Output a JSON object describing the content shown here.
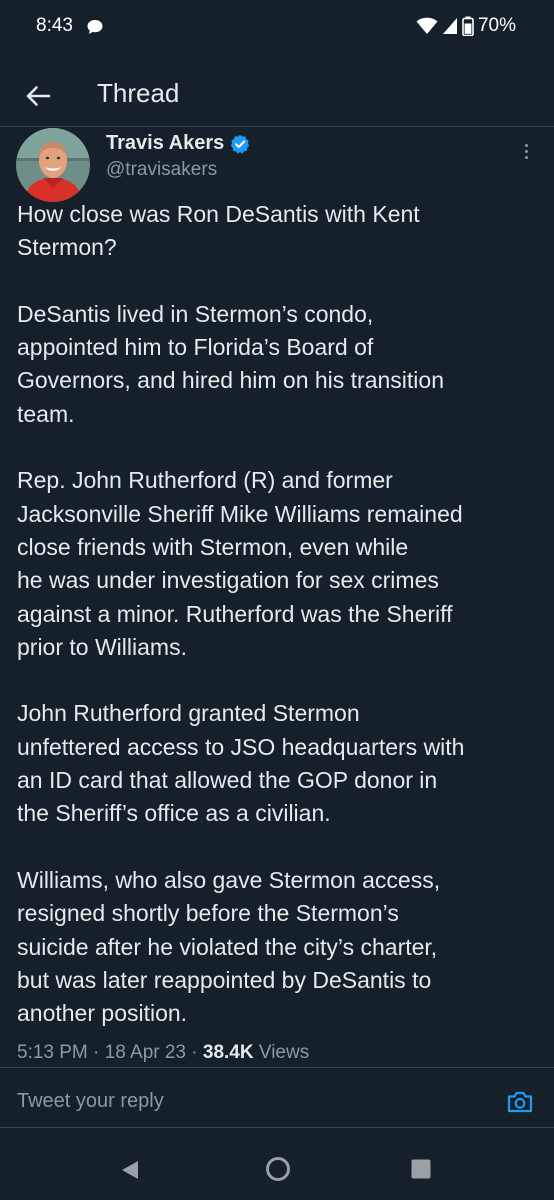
{
  "status_bar": {
    "time": "8:43",
    "battery": "70%"
  },
  "header": {
    "title": "Thread"
  },
  "tweet": {
    "author_name": "Travis Akers",
    "author_handle": "@travisakers",
    "paragraphs": [
      "How close was Ron DeSantis with Kent\nStermon?",
      "DeSantis lived in Stermon’s condo,\nappointed him to Florida’s Board of\nGovernors, and hired him on his transition\nteam.",
      "Rep. John Rutherford (R) and former\nJacksonville Sheriff Mike Williams remained\nclose friends with Stermon, even while\nhe was under investigation for sex crimes\nagainst a minor. Rutherford was the Sheriff\nprior to Williams.",
      "John Rutherford granted Stermon\nunfettered access to JSO headquarters with\nan ID card that allowed the GOP donor in\nthe Sheriff’s office as a civilian.",
      "Williams, who also gave Stermon access,\nresigned shortly before the Stermon’s\nsuicide after he violated the city’s charter,\nbut was later reappointed by DeSantis to\nanother position."
    ],
    "time": "5:13 PM",
    "date": "18 Apr 23",
    "views_count": "38.4K",
    "views_label": "Views"
  },
  "reply": {
    "placeholder": "Tweet your reply"
  },
  "colors": {
    "background": "#15202b",
    "accent": "#1d9bf0",
    "text": "#e7e9ea",
    "muted": "#8b98a5"
  },
  "icons": {
    "back": "arrow-left-icon",
    "verified": "verified-badge-icon",
    "more": "more-vertical-icon",
    "camera": "camera-icon"
  }
}
